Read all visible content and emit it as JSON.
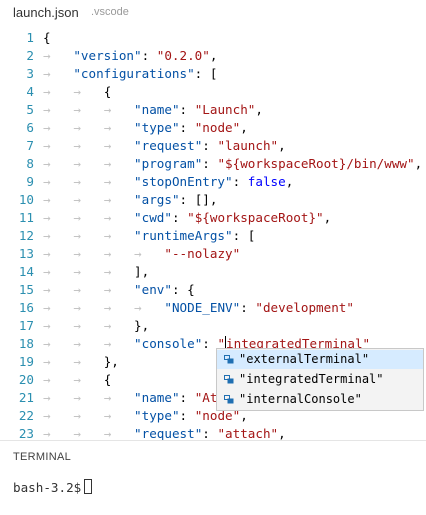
{
  "tab": {
    "filename": "launch.json",
    "folder": ".vscode"
  },
  "editor": {
    "lines": [
      {
        "n": "1",
        "indent": 0,
        "parts": [
          {
            "t": "{",
            "c": "p"
          }
        ]
      },
      {
        "n": "2",
        "indent": 1,
        "parts": [
          {
            "t": "\"version\"",
            "c": "k"
          },
          {
            "t": ": ",
            "c": "p"
          },
          {
            "t": "\"0.2.0\"",
            "c": "s"
          },
          {
            "t": ",",
            "c": "p"
          }
        ]
      },
      {
        "n": "3",
        "indent": 1,
        "parts": [
          {
            "t": "\"configurations\"",
            "c": "k"
          },
          {
            "t": ": [",
            "c": "p"
          }
        ]
      },
      {
        "n": "4",
        "indent": 2,
        "parts": [
          {
            "t": "{",
            "c": "p"
          }
        ]
      },
      {
        "n": "5",
        "indent": 3,
        "parts": [
          {
            "t": "\"name\"",
            "c": "k"
          },
          {
            "t": ": ",
            "c": "p"
          },
          {
            "t": "\"Launch\"",
            "c": "s"
          },
          {
            "t": ",",
            "c": "p"
          }
        ]
      },
      {
        "n": "6",
        "indent": 3,
        "parts": [
          {
            "t": "\"type\"",
            "c": "k"
          },
          {
            "t": ": ",
            "c": "p"
          },
          {
            "t": "\"node\"",
            "c": "s"
          },
          {
            "t": ",",
            "c": "p"
          }
        ]
      },
      {
        "n": "7",
        "indent": 3,
        "parts": [
          {
            "t": "\"request\"",
            "c": "k"
          },
          {
            "t": ": ",
            "c": "p"
          },
          {
            "t": "\"launch\"",
            "c": "s"
          },
          {
            "t": ",",
            "c": "p"
          }
        ]
      },
      {
        "n": "8",
        "indent": 3,
        "parts": [
          {
            "t": "\"program\"",
            "c": "k"
          },
          {
            "t": ": ",
            "c": "p"
          },
          {
            "t": "\"${workspaceRoot}/bin/www\"",
            "c": "s"
          },
          {
            "t": ",",
            "c": "p"
          }
        ]
      },
      {
        "n": "9",
        "indent": 3,
        "parts": [
          {
            "t": "\"stopOnEntry\"",
            "c": "k"
          },
          {
            "t": ": ",
            "c": "p"
          },
          {
            "t": "false",
            "c": "kw"
          },
          {
            "t": ",",
            "c": "p"
          }
        ]
      },
      {
        "n": "10",
        "indent": 3,
        "parts": [
          {
            "t": "\"args\"",
            "c": "k"
          },
          {
            "t": ": [],",
            "c": "p"
          }
        ]
      },
      {
        "n": "11",
        "indent": 3,
        "parts": [
          {
            "t": "\"cwd\"",
            "c": "k"
          },
          {
            "t": ": ",
            "c": "p"
          },
          {
            "t": "\"${workspaceRoot}\"",
            "c": "s"
          },
          {
            "t": ",",
            "c": "p"
          }
        ]
      },
      {
        "n": "12",
        "indent": 3,
        "parts": [
          {
            "t": "\"runtimeArgs\"",
            "c": "k"
          },
          {
            "t": ": [",
            "c": "p"
          }
        ]
      },
      {
        "n": "13",
        "indent": 4,
        "parts": [
          {
            "t": "\"--nolazy\"",
            "c": "s"
          }
        ]
      },
      {
        "n": "14",
        "indent": 3,
        "parts": [
          {
            "t": "],",
            "c": "p"
          }
        ]
      },
      {
        "n": "15",
        "indent": 3,
        "parts": [
          {
            "t": "\"env\"",
            "c": "k"
          },
          {
            "t": ": {",
            "c": "p"
          }
        ]
      },
      {
        "n": "16",
        "indent": 4,
        "parts": [
          {
            "t": "\"NODE_ENV\"",
            "c": "k"
          },
          {
            "t": ": ",
            "c": "p"
          },
          {
            "t": "\"development\"",
            "c": "s"
          }
        ]
      },
      {
        "n": "17",
        "indent": 3,
        "parts": [
          {
            "t": "},",
            "c": "p"
          }
        ]
      },
      {
        "n": "18",
        "indent": 3,
        "parts": [
          {
            "t": "\"console\"",
            "c": "k"
          },
          {
            "t": ": ",
            "c": "p"
          },
          {
            "t": "\"",
            "c": "s"
          },
          {
            "t": "|",
            "c": "cursor"
          },
          {
            "t": "integratedTerminal\"",
            "c": "s"
          }
        ]
      },
      {
        "n": "19",
        "indent": 2,
        "parts": [
          {
            "t": "},",
            "c": "p"
          }
        ]
      },
      {
        "n": "20",
        "indent": 2,
        "parts": [
          {
            "t": "{",
            "c": "p"
          }
        ]
      },
      {
        "n": "21",
        "indent": 3,
        "parts": [
          {
            "t": "\"name\"",
            "c": "k"
          },
          {
            "t": ": ",
            "c": "p"
          },
          {
            "t": "\"Att",
            "c": "s"
          }
        ]
      },
      {
        "n": "22",
        "indent": 3,
        "parts": [
          {
            "t": "\"type\"",
            "c": "k"
          },
          {
            "t": ": ",
            "c": "p"
          },
          {
            "t": "\"node\"",
            "c": "s"
          },
          {
            "t": ",",
            "c": "p"
          }
        ]
      },
      {
        "n": "23",
        "indent": 3,
        "parts": [
          {
            "t": "\"request\"",
            "c": "k"
          },
          {
            "t": ": ",
            "c": "p"
          },
          {
            "t": "\"attach\"",
            "c": "s"
          },
          {
            "t": ",",
            "c": "p"
          }
        ]
      }
    ]
  },
  "suggestions": {
    "items": [
      {
        "label": "\"externalTerminal\"",
        "selected": true
      },
      {
        "label": "\"integratedTerminal\"",
        "selected": false
      },
      {
        "label": "\"internalConsole\"",
        "selected": false
      }
    ]
  },
  "panel": {
    "title": "TERMINAL"
  },
  "terminal": {
    "prompt": "bash-3.2$"
  },
  "colors": {
    "key": "#0451a5",
    "string": "#a31515",
    "keyword": "#0000ff",
    "line_number": "#2b8fb0",
    "selection": "#d6ebff"
  }
}
